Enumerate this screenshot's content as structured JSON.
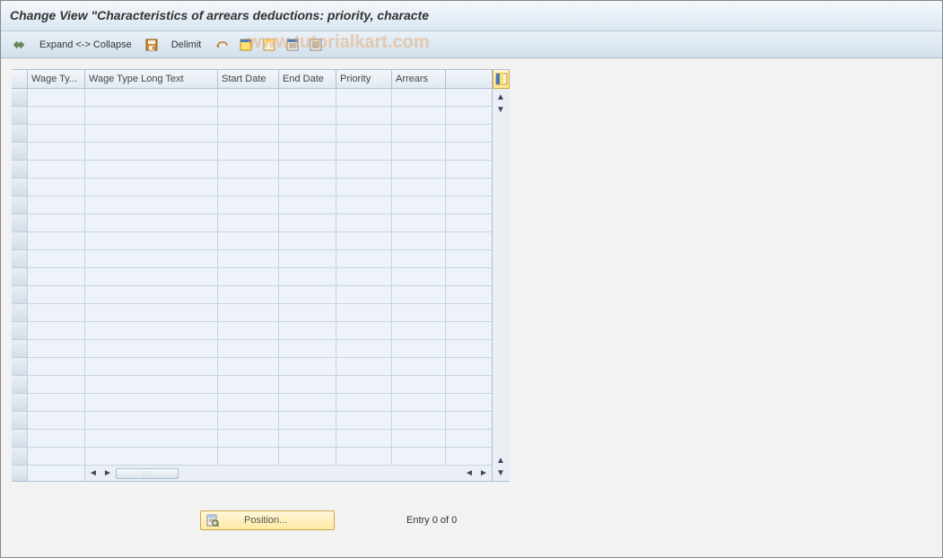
{
  "title": "Change View \"Characteristics of arrears deductions: priority, characte",
  "watermark": "www.tutorialkart.com",
  "toolbar": {
    "expand_collapse": "Expand <-> Collapse",
    "delimit": "Delimit"
  },
  "columns": [
    "Wage Ty...",
    "Wage Type Long Text",
    "Start Date",
    "End Date",
    "Priority",
    "Arrears"
  ],
  "footer": {
    "position_label": "Position...",
    "entry_text": "Entry 0 of 0"
  }
}
